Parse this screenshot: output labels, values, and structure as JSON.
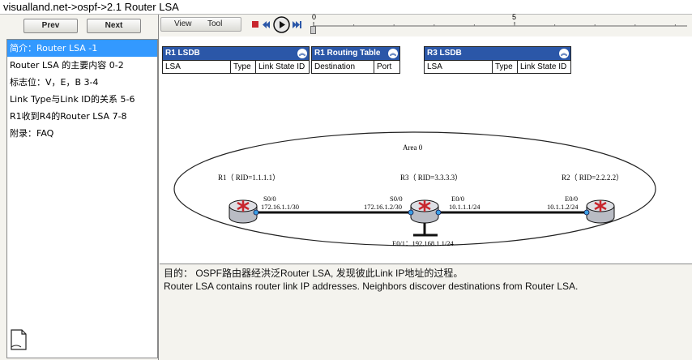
{
  "window": {
    "title": "visualland.net->ospf->2.1 Router LSA"
  },
  "nav": {
    "prev_label": "Prev",
    "next_label": "Next"
  },
  "toolbar": {
    "view_label": "View",
    "tool_label": "Tool",
    "timeline": {
      "tick_start": "0",
      "tick_mid": "5",
      "progress": 0.0
    }
  },
  "outline": {
    "items": [
      {
        "label": "简介：Router LSA -1",
        "selected": true
      },
      {
        "label": "Router LSA 的主要内容 0-2",
        "selected": false
      },
      {
        "label": "标志位：V，E，B 3-4",
        "selected": false
      },
      {
        "label": "Link Type与Link ID的关系 5-6",
        "selected": false
      },
      {
        "label": "R1收到R4的Router LSA 7-8",
        "selected": false
      },
      {
        "label": "附录：FAQ",
        "selected": false
      }
    ]
  },
  "tables": {
    "r1_lsdb": {
      "title": "R1 LSDB",
      "cols": [
        "LSA",
        "Type",
        "Link State ID"
      ]
    },
    "r1_routing": {
      "title": "R1 Routing Table",
      "cols": [
        "Destination",
        "Port"
      ]
    },
    "r3_lsdb": {
      "title": "R3 LSDB",
      "cols": [
        "LSA",
        "Type",
        "Link State ID"
      ]
    }
  },
  "topology": {
    "area_label": "Area 0",
    "r1": {
      "name": "R1（ RID=1.1.1.1）",
      "port": "S0/0",
      "ip": "172.16.1.1/30"
    },
    "r3": {
      "name": "R3（ RID=3.3.3.3）",
      "port_left": "S0/0",
      "ip_left": "172.16.1.2/30",
      "port_right": "E0/0",
      "ip_right": "10.1.1.1/24",
      "port_bottom": "E0/1：192.168.1.1/24"
    },
    "r2": {
      "name": "R2（ RID=2.2.2.2）",
      "port": "E0/0",
      "ip": "10.1.1.2/24"
    }
  },
  "description": {
    "line1": "目的：  OSPF路由器经洪泛Router LSA, 发现彼此Link IP地址的过程。",
    "line2": "Router LSA contains router link IP addresses. Neighbors discover destinations from Router LSA."
  },
  "colors": {
    "selection": "#3399ff",
    "table_header": "#2b57a8",
    "panel_bg": "#f4f3ee"
  }
}
